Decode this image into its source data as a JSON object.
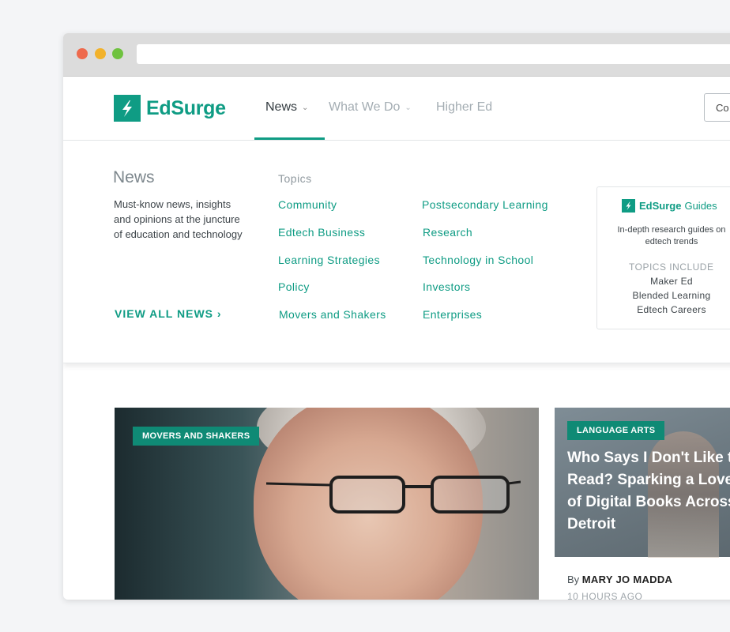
{
  "colors": {
    "brand": "#0f9c84",
    "tag": "#0f8a75"
  },
  "header": {
    "logo_text": "EdSurge",
    "nav": [
      {
        "label": "News",
        "icon": "chevron-down-icon"
      },
      {
        "label": "What We Do",
        "icon": "chevron-down-icon"
      },
      {
        "label": "Higher Ed"
      }
    ],
    "button_label": "Co"
  },
  "mega_menu": {
    "title": "News",
    "description": "Must-know news, insights and opinions at the juncture of education and technology",
    "view_all": "VIEW ALL NEWS ›",
    "topics_label": "Topics",
    "topics_col1": [
      "Community",
      "Edtech Business",
      "Learning Strategies",
      "Policy",
      "Movers and Shakers"
    ],
    "topics_col2": [
      "Postsecondary Learning",
      "Research",
      "Technology in School",
      "Investors",
      "Enterprises"
    ],
    "guide": {
      "brand": "EdSurge",
      "word": "Guides",
      "subtitle": "In-depth research guides on edtech trends",
      "topics_label": "TOPICS INCLUDE",
      "topics": [
        "Maker Ed",
        "Blended Learning",
        "Edtech Careers"
      ]
    }
  },
  "articles": {
    "featured": {
      "tag": "MOVERS AND SHAKERS"
    },
    "secondary": {
      "tag": "LANGUAGE ARTS",
      "headline": "Who Says I Don't Like to Read? Sparking a Love of Digital Books Across Detroit",
      "by_prefix": "By ",
      "author": "MARY JO MADDA",
      "timestamp": "10 HOURS AGO"
    }
  }
}
